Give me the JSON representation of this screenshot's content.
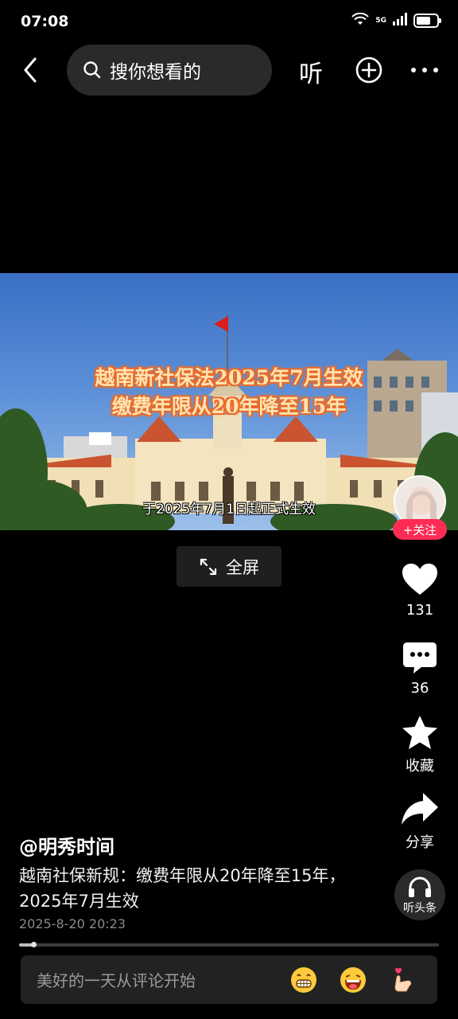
{
  "status_bar": {
    "time": "07:08",
    "network": "5G",
    "battery_level": 0.75
  },
  "top_bar": {
    "search_placeholder": "搜你想看的",
    "listen_label": "听"
  },
  "video": {
    "overlay_title_line1": "越南新社保法2025年7月生效",
    "overlay_title_line2": "缴费年限从20年降至15年",
    "subtitle": "于2025年7月1日起正式生效",
    "fullscreen_label": "全屏"
  },
  "actions": {
    "follow_label": "+关注",
    "like_count": "131",
    "comment_count": "36",
    "collect_label": "收藏",
    "share_label": "分享",
    "listen_label": "听头条"
  },
  "post": {
    "author": "@明秀时间",
    "description": "越南社保新规：缴费年限从20年降至15年，2025年7月生效",
    "date": "2025-8-20 20:23",
    "progress": 0.035
  },
  "comment_bar": {
    "placeholder": "美好的一天从评论开始",
    "emojis": [
      "grinning-emoji",
      "laughing-emoji",
      "finger-heart-emoji"
    ]
  },
  "colors": {
    "accent": "#fe2c55",
    "background": "#000000",
    "overlay_text": "#ffe3b0",
    "overlay_stroke": "#e86a2a"
  }
}
